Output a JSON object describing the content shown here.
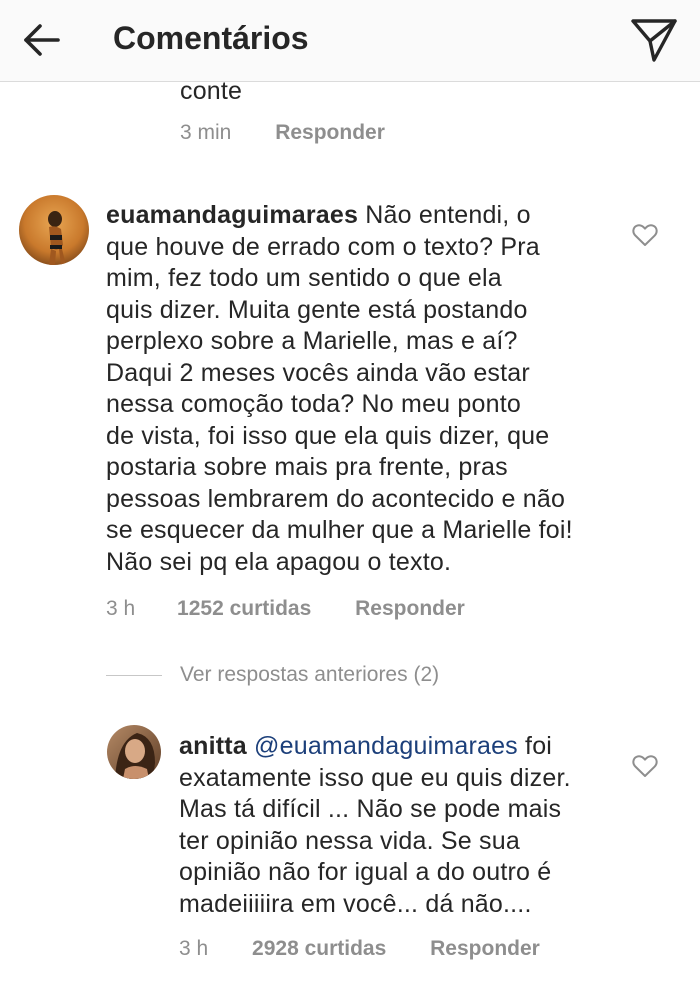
{
  "header": {
    "title": "Comentários",
    "back_icon": "arrow-left-icon",
    "send_icon": "paper-plane-icon"
  },
  "truncated_comment": {
    "tail_text": "conte",
    "time": "3 min",
    "reply_label": "Responder"
  },
  "comment1": {
    "username": "euamandaguimaraes",
    "text": "Não entendi, o que houve de errado com o texto? Pra mim, fez todo um sentido o que ela quis dizer. Muita gente está postando perplexo sobre a Marielle, mas e aí? Daqui 2 meses vocês ainda vão estar nessa comoção toda? No meu ponto de vista, foi isso que ela quis dizer, que postaria sobre mais pra frente, pras pessoas lembrarem do acontecido e não se esquecer da mulher que a Marielle foi! Não sei pq ela apagou o texto.",
    "lines": [
      "Não entendi, o",
      "que houve de errado com o texto? Pra",
      "mim, fez todo um sentido o que ela",
      "quis dizer. Muita gente está postando",
      "perplexo sobre a Marielle, mas e aí?",
      "Daqui 2 meses vocês ainda vão estar",
      "nessa comoção toda? No meu ponto",
      "de vista, foi isso que ela quis dizer, que",
      "postaria sobre mais pra frente, pras",
      "pessoas lembrarem do acontecido e não",
      "se esquecer da mulher que a Marielle foi!",
      "Não sei pq ela apagou o texto."
    ],
    "time": "3 h",
    "likes": "1252 curtidas",
    "reply_label": "Responder",
    "heart_icon": "heart-outline-icon"
  },
  "view_previous": {
    "label": "Ver respostas anteriores (2)"
  },
  "reply1": {
    "username": "anitta",
    "mention": "@euamandaguimaraes",
    "lines_after_mention": [
      "foi",
      "exatamente isso que eu quis dizer.",
      "Mas tá difícil ... Não se pode mais",
      "ter opinião nessa vida. Se sua",
      "opinião não for igual a do outro é",
      "madeiiiiira em você... dá não...."
    ],
    "time": "3 h",
    "likes": "2928 curtidas",
    "reply_label": "Responder",
    "heart_icon": "heart-outline-icon"
  },
  "colors": {
    "text": "#262626",
    "secondary": "#8e8e8e",
    "mention": "#1c3f7a",
    "header_bg": "#fafafa"
  }
}
